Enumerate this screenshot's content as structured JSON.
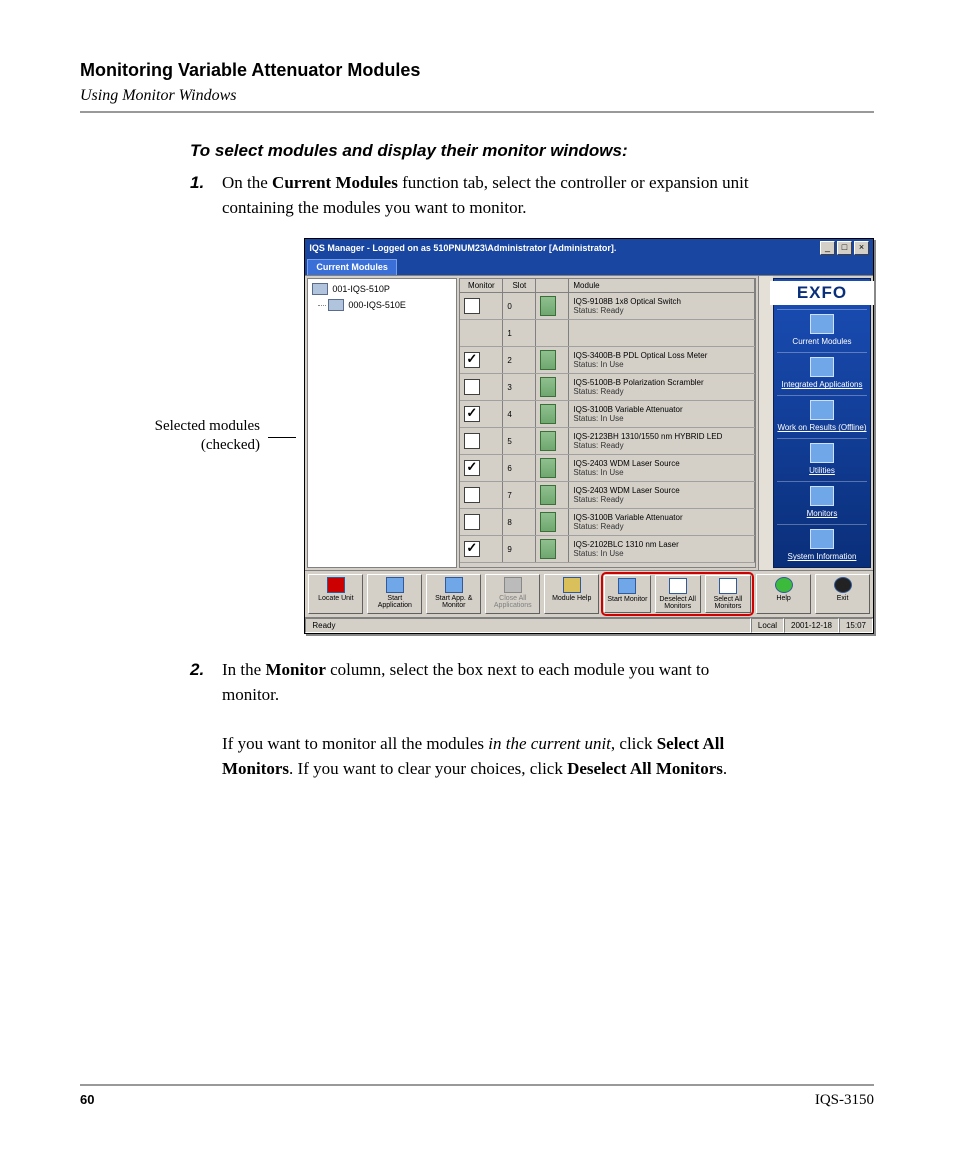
{
  "header": {
    "chapter": "Monitoring Variable Attenuator Modules",
    "section": "Using Monitor Windows"
  },
  "procedure": {
    "title": "To select modules and display their monitor windows:",
    "step1_num": "1.",
    "step1_a": "On the ",
    "step1_b": "Current Modules",
    "step1_c": " function tab, select the controller or expansion unit containing the modules you want to monitor.",
    "step2_num": "2.",
    "step2_a": "In the ",
    "step2_b": "Monitor",
    "step2_c": " column, select the box next to each module you want to monitor.",
    "step2_p2_a": "If you want to monitor all the modules ",
    "step2_p2_b": "in the current unit",
    "step2_p2_c": ", click ",
    "step2_p2_d": "Select All Monitors",
    "step2_p2_e": ". If you want to clear your choices, click ",
    "step2_p2_f": "Deselect All Monitors",
    "step2_p2_g": "."
  },
  "callout": "Selected modules (checked)",
  "app": {
    "title": "IQS Manager - Logged on as 510PNUM23\\Administrator [Administrator].",
    "tab": "Current Modules",
    "brand": "EXFO",
    "tree": {
      "root_label": "iqs-510P",
      "unit1": "001-IQS-510P",
      "unit2": "000-IQS-510E",
      "child_label": "iqs-510E"
    },
    "cols": {
      "monitor": "Monitor",
      "slot": "Slot",
      "module": "Module"
    },
    "status_prefix": "Status:",
    "modules": [
      {
        "slot": "0",
        "checked": false,
        "name": "IQS-9108B 1x8 Optical Switch",
        "status": "Ready"
      },
      {
        "slot": "1",
        "checked": null,
        "name": "",
        "status": ""
      },
      {
        "slot": "2",
        "checked": true,
        "name": "IQS-3400B-B PDL Optical Loss Meter",
        "status": "In Use"
      },
      {
        "slot": "3",
        "checked": false,
        "name": "IQS-5100B-B Polarization Scrambler",
        "status": "Ready"
      },
      {
        "slot": "4",
        "checked": true,
        "name": "IQS-3100B Variable Attenuator",
        "status": "In Use"
      },
      {
        "slot": "5",
        "checked": false,
        "name": "IQS-2123BH 1310/1550 nm HYBRID LED",
        "status": "Ready"
      },
      {
        "slot": "6",
        "checked": true,
        "name": "IQS-2403 WDM Laser Source",
        "status": "In Use"
      },
      {
        "slot": "7",
        "checked": false,
        "name": "IQS-2403 WDM Laser Source",
        "status": "Ready"
      },
      {
        "slot": "8",
        "checked": false,
        "name": "IQS-3100B Variable Attenuator",
        "status": "Ready"
      },
      {
        "slot": "9",
        "checked": true,
        "name": "IQS-2102BLC 1310 nm Laser",
        "status": "In Use"
      }
    ],
    "nav": [
      "Current Modules",
      "Integrated Applications",
      "Work on Results (Offline)",
      "Utilities",
      "Monitors",
      "System Information"
    ],
    "buttons": {
      "locate": "Locate Unit",
      "start_app": "Start Application",
      "start_app_mon": "Start App. & Monitor",
      "close_all": "Close All Applications",
      "module_help": "Module Help",
      "start_monitor": "Start Monitor",
      "deselect": "Deselect All Monitors",
      "select": "Select All Monitors",
      "help": "Help",
      "exit": "Exit"
    },
    "status": {
      "left": "Ready",
      "mid": "Local",
      "date": "2001-12-18",
      "time": "15:07"
    }
  },
  "footer": {
    "page": "60",
    "doc": "IQS-3150"
  }
}
